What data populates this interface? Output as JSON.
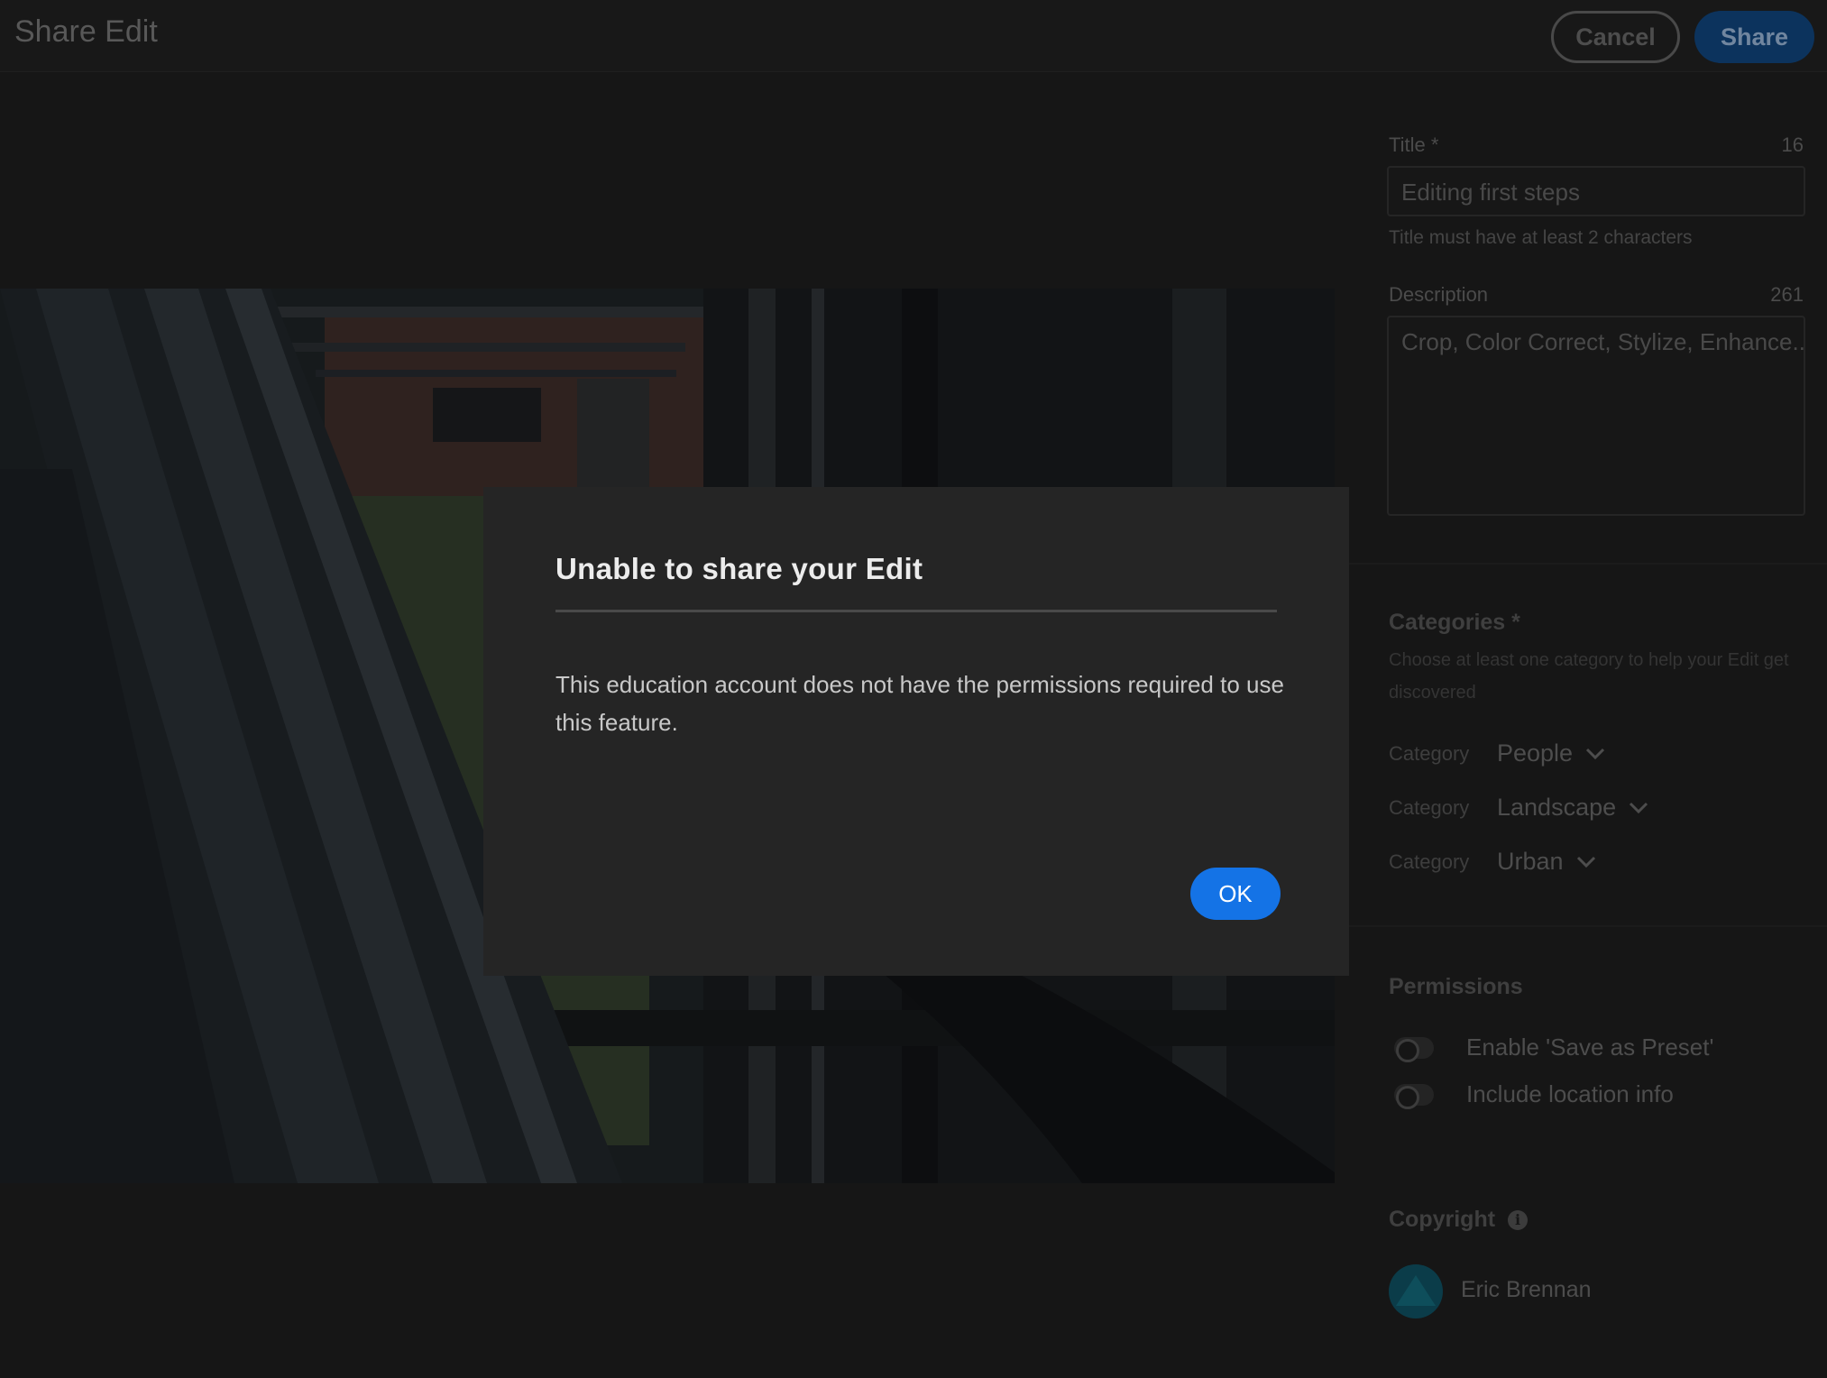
{
  "header": {
    "title": "Share Edit",
    "cancel_label": "Cancel",
    "share_label": "Share"
  },
  "form": {
    "title_label": "Title *",
    "title_counter": "16",
    "title_value": "Editing first steps",
    "title_helper": "Title must have at least 2 characters",
    "description_label": "Description",
    "description_counter": "261",
    "description_value": "Crop, Color Correct, Stylize, Enhance..."
  },
  "categories": {
    "title": "Categories *",
    "help": "Choose at least one category to help your Edit get discovered",
    "items": [
      {
        "label": "Category",
        "value": "People"
      },
      {
        "label": "Category",
        "value": "Landscape"
      },
      {
        "label": "Category",
        "value": "Urban"
      }
    ]
  },
  "permissions": {
    "title": "Permissions",
    "toggles": [
      {
        "label": "Enable 'Save as Preset'",
        "on": false
      },
      {
        "label": "Include location info",
        "on": false
      }
    ]
  },
  "copyright": {
    "title": "Copyright",
    "info_icon": "info-icon",
    "owner": "Eric Brennan"
  },
  "dialog": {
    "title": "Unable to share your Edit",
    "body": "This education account does not have the permissions required to use this feature.",
    "ok_label": "OK"
  },
  "colors": {
    "accent": "#1473e6",
    "share_button_dimmed": "#0f3f72",
    "avatar": "#0e4a5a"
  }
}
